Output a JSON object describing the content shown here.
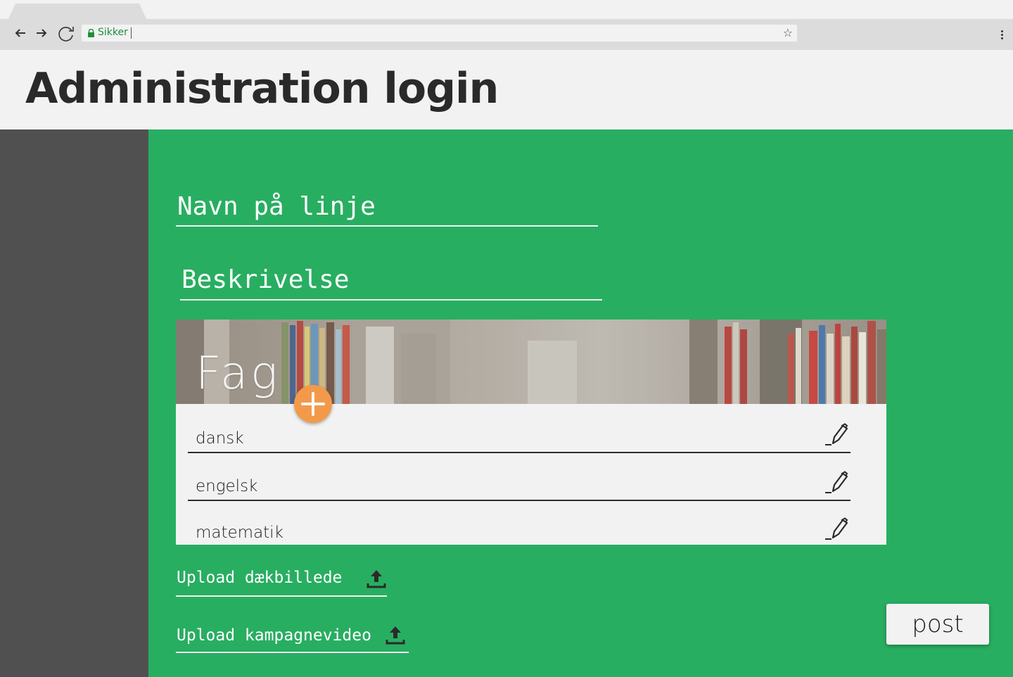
{
  "browser": {
    "security_label": "Sikker",
    "url": "",
    "icons": {
      "back": "arrow-left-icon",
      "forward": "arrow-right-icon",
      "reload": "reload-icon",
      "lock": "lock-icon",
      "bookmark": "star-icon",
      "menu": "more-vert-icon"
    }
  },
  "header": {
    "title": "Administration login"
  },
  "form": {
    "name_field": {
      "placeholder": "Navn på linje",
      "value": ""
    },
    "description_field": {
      "placeholder": "Beskrivelse",
      "value": ""
    }
  },
  "fag": {
    "title": "Fag",
    "add_icon": "plus-icon",
    "edit_icon": "pencil-icon",
    "subjects": [
      "dansk",
      "engelsk",
      "matematik"
    ]
  },
  "uploads": {
    "cover": {
      "label": "Upload dækbillede",
      "icon": "upload-icon"
    },
    "video": {
      "label": "Upload kampagnevideo",
      "icon": "upload-icon"
    }
  },
  "actions": {
    "post_label": "post"
  },
  "colors": {
    "primary_green": "#28ae61",
    "sidebar_gray": "#505050",
    "accent_orange": "#f39a4a",
    "light_bg": "#f2f2f2",
    "secure_green": "#1e8e3e"
  }
}
